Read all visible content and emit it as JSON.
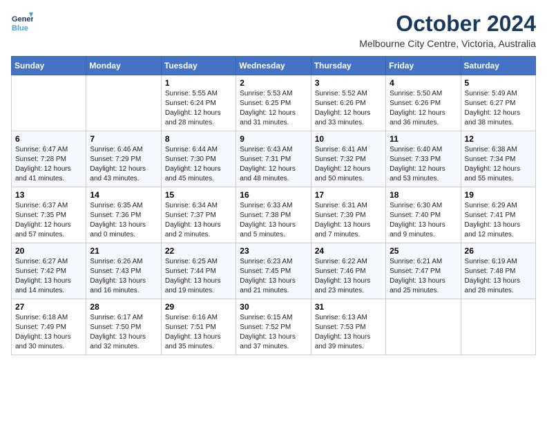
{
  "header": {
    "logo_line1": "General",
    "logo_line2": "Blue",
    "title": "October 2024",
    "subtitle": "Melbourne City Centre, Victoria, Australia"
  },
  "weekdays": [
    "Sunday",
    "Monday",
    "Tuesday",
    "Wednesday",
    "Thursday",
    "Friday",
    "Saturday"
  ],
  "weeks": [
    [
      {
        "day": "",
        "info": ""
      },
      {
        "day": "",
        "info": ""
      },
      {
        "day": "1",
        "info": "Sunrise: 5:55 AM\nSunset: 6:24 PM\nDaylight: 12 hours and 28 minutes."
      },
      {
        "day": "2",
        "info": "Sunrise: 5:53 AM\nSunset: 6:25 PM\nDaylight: 12 hours and 31 minutes."
      },
      {
        "day": "3",
        "info": "Sunrise: 5:52 AM\nSunset: 6:26 PM\nDaylight: 12 hours and 33 minutes."
      },
      {
        "day": "4",
        "info": "Sunrise: 5:50 AM\nSunset: 6:26 PM\nDaylight: 12 hours and 36 minutes."
      },
      {
        "day": "5",
        "info": "Sunrise: 5:49 AM\nSunset: 6:27 PM\nDaylight: 12 hours and 38 minutes."
      }
    ],
    [
      {
        "day": "6",
        "info": "Sunrise: 6:47 AM\nSunset: 7:28 PM\nDaylight: 12 hours and 41 minutes."
      },
      {
        "day": "7",
        "info": "Sunrise: 6:46 AM\nSunset: 7:29 PM\nDaylight: 12 hours and 43 minutes."
      },
      {
        "day": "8",
        "info": "Sunrise: 6:44 AM\nSunset: 7:30 PM\nDaylight: 12 hours and 45 minutes."
      },
      {
        "day": "9",
        "info": "Sunrise: 6:43 AM\nSunset: 7:31 PM\nDaylight: 12 hours and 48 minutes."
      },
      {
        "day": "10",
        "info": "Sunrise: 6:41 AM\nSunset: 7:32 PM\nDaylight: 12 hours and 50 minutes."
      },
      {
        "day": "11",
        "info": "Sunrise: 6:40 AM\nSunset: 7:33 PM\nDaylight: 12 hours and 53 minutes."
      },
      {
        "day": "12",
        "info": "Sunrise: 6:38 AM\nSunset: 7:34 PM\nDaylight: 12 hours and 55 minutes."
      }
    ],
    [
      {
        "day": "13",
        "info": "Sunrise: 6:37 AM\nSunset: 7:35 PM\nDaylight: 12 hours and 57 minutes."
      },
      {
        "day": "14",
        "info": "Sunrise: 6:35 AM\nSunset: 7:36 PM\nDaylight: 13 hours and 0 minutes."
      },
      {
        "day": "15",
        "info": "Sunrise: 6:34 AM\nSunset: 7:37 PM\nDaylight: 13 hours and 2 minutes."
      },
      {
        "day": "16",
        "info": "Sunrise: 6:33 AM\nSunset: 7:38 PM\nDaylight: 13 hours and 5 minutes."
      },
      {
        "day": "17",
        "info": "Sunrise: 6:31 AM\nSunset: 7:39 PM\nDaylight: 13 hours and 7 minutes."
      },
      {
        "day": "18",
        "info": "Sunrise: 6:30 AM\nSunset: 7:40 PM\nDaylight: 13 hours and 9 minutes."
      },
      {
        "day": "19",
        "info": "Sunrise: 6:29 AM\nSunset: 7:41 PM\nDaylight: 13 hours and 12 minutes."
      }
    ],
    [
      {
        "day": "20",
        "info": "Sunrise: 6:27 AM\nSunset: 7:42 PM\nDaylight: 13 hours and 14 minutes."
      },
      {
        "day": "21",
        "info": "Sunrise: 6:26 AM\nSunset: 7:43 PM\nDaylight: 13 hours and 16 minutes."
      },
      {
        "day": "22",
        "info": "Sunrise: 6:25 AM\nSunset: 7:44 PM\nDaylight: 13 hours and 19 minutes."
      },
      {
        "day": "23",
        "info": "Sunrise: 6:23 AM\nSunset: 7:45 PM\nDaylight: 13 hours and 21 minutes."
      },
      {
        "day": "24",
        "info": "Sunrise: 6:22 AM\nSunset: 7:46 PM\nDaylight: 13 hours and 23 minutes."
      },
      {
        "day": "25",
        "info": "Sunrise: 6:21 AM\nSunset: 7:47 PM\nDaylight: 13 hours and 25 minutes."
      },
      {
        "day": "26",
        "info": "Sunrise: 6:19 AM\nSunset: 7:48 PM\nDaylight: 13 hours and 28 minutes."
      }
    ],
    [
      {
        "day": "27",
        "info": "Sunrise: 6:18 AM\nSunset: 7:49 PM\nDaylight: 13 hours and 30 minutes."
      },
      {
        "day": "28",
        "info": "Sunrise: 6:17 AM\nSunset: 7:50 PM\nDaylight: 13 hours and 32 minutes."
      },
      {
        "day": "29",
        "info": "Sunrise: 6:16 AM\nSunset: 7:51 PM\nDaylight: 13 hours and 35 minutes."
      },
      {
        "day": "30",
        "info": "Sunrise: 6:15 AM\nSunset: 7:52 PM\nDaylight: 13 hours and 37 minutes."
      },
      {
        "day": "31",
        "info": "Sunrise: 6:13 AM\nSunset: 7:53 PM\nDaylight: 13 hours and 39 minutes."
      },
      {
        "day": "",
        "info": ""
      },
      {
        "day": "",
        "info": ""
      }
    ]
  ]
}
